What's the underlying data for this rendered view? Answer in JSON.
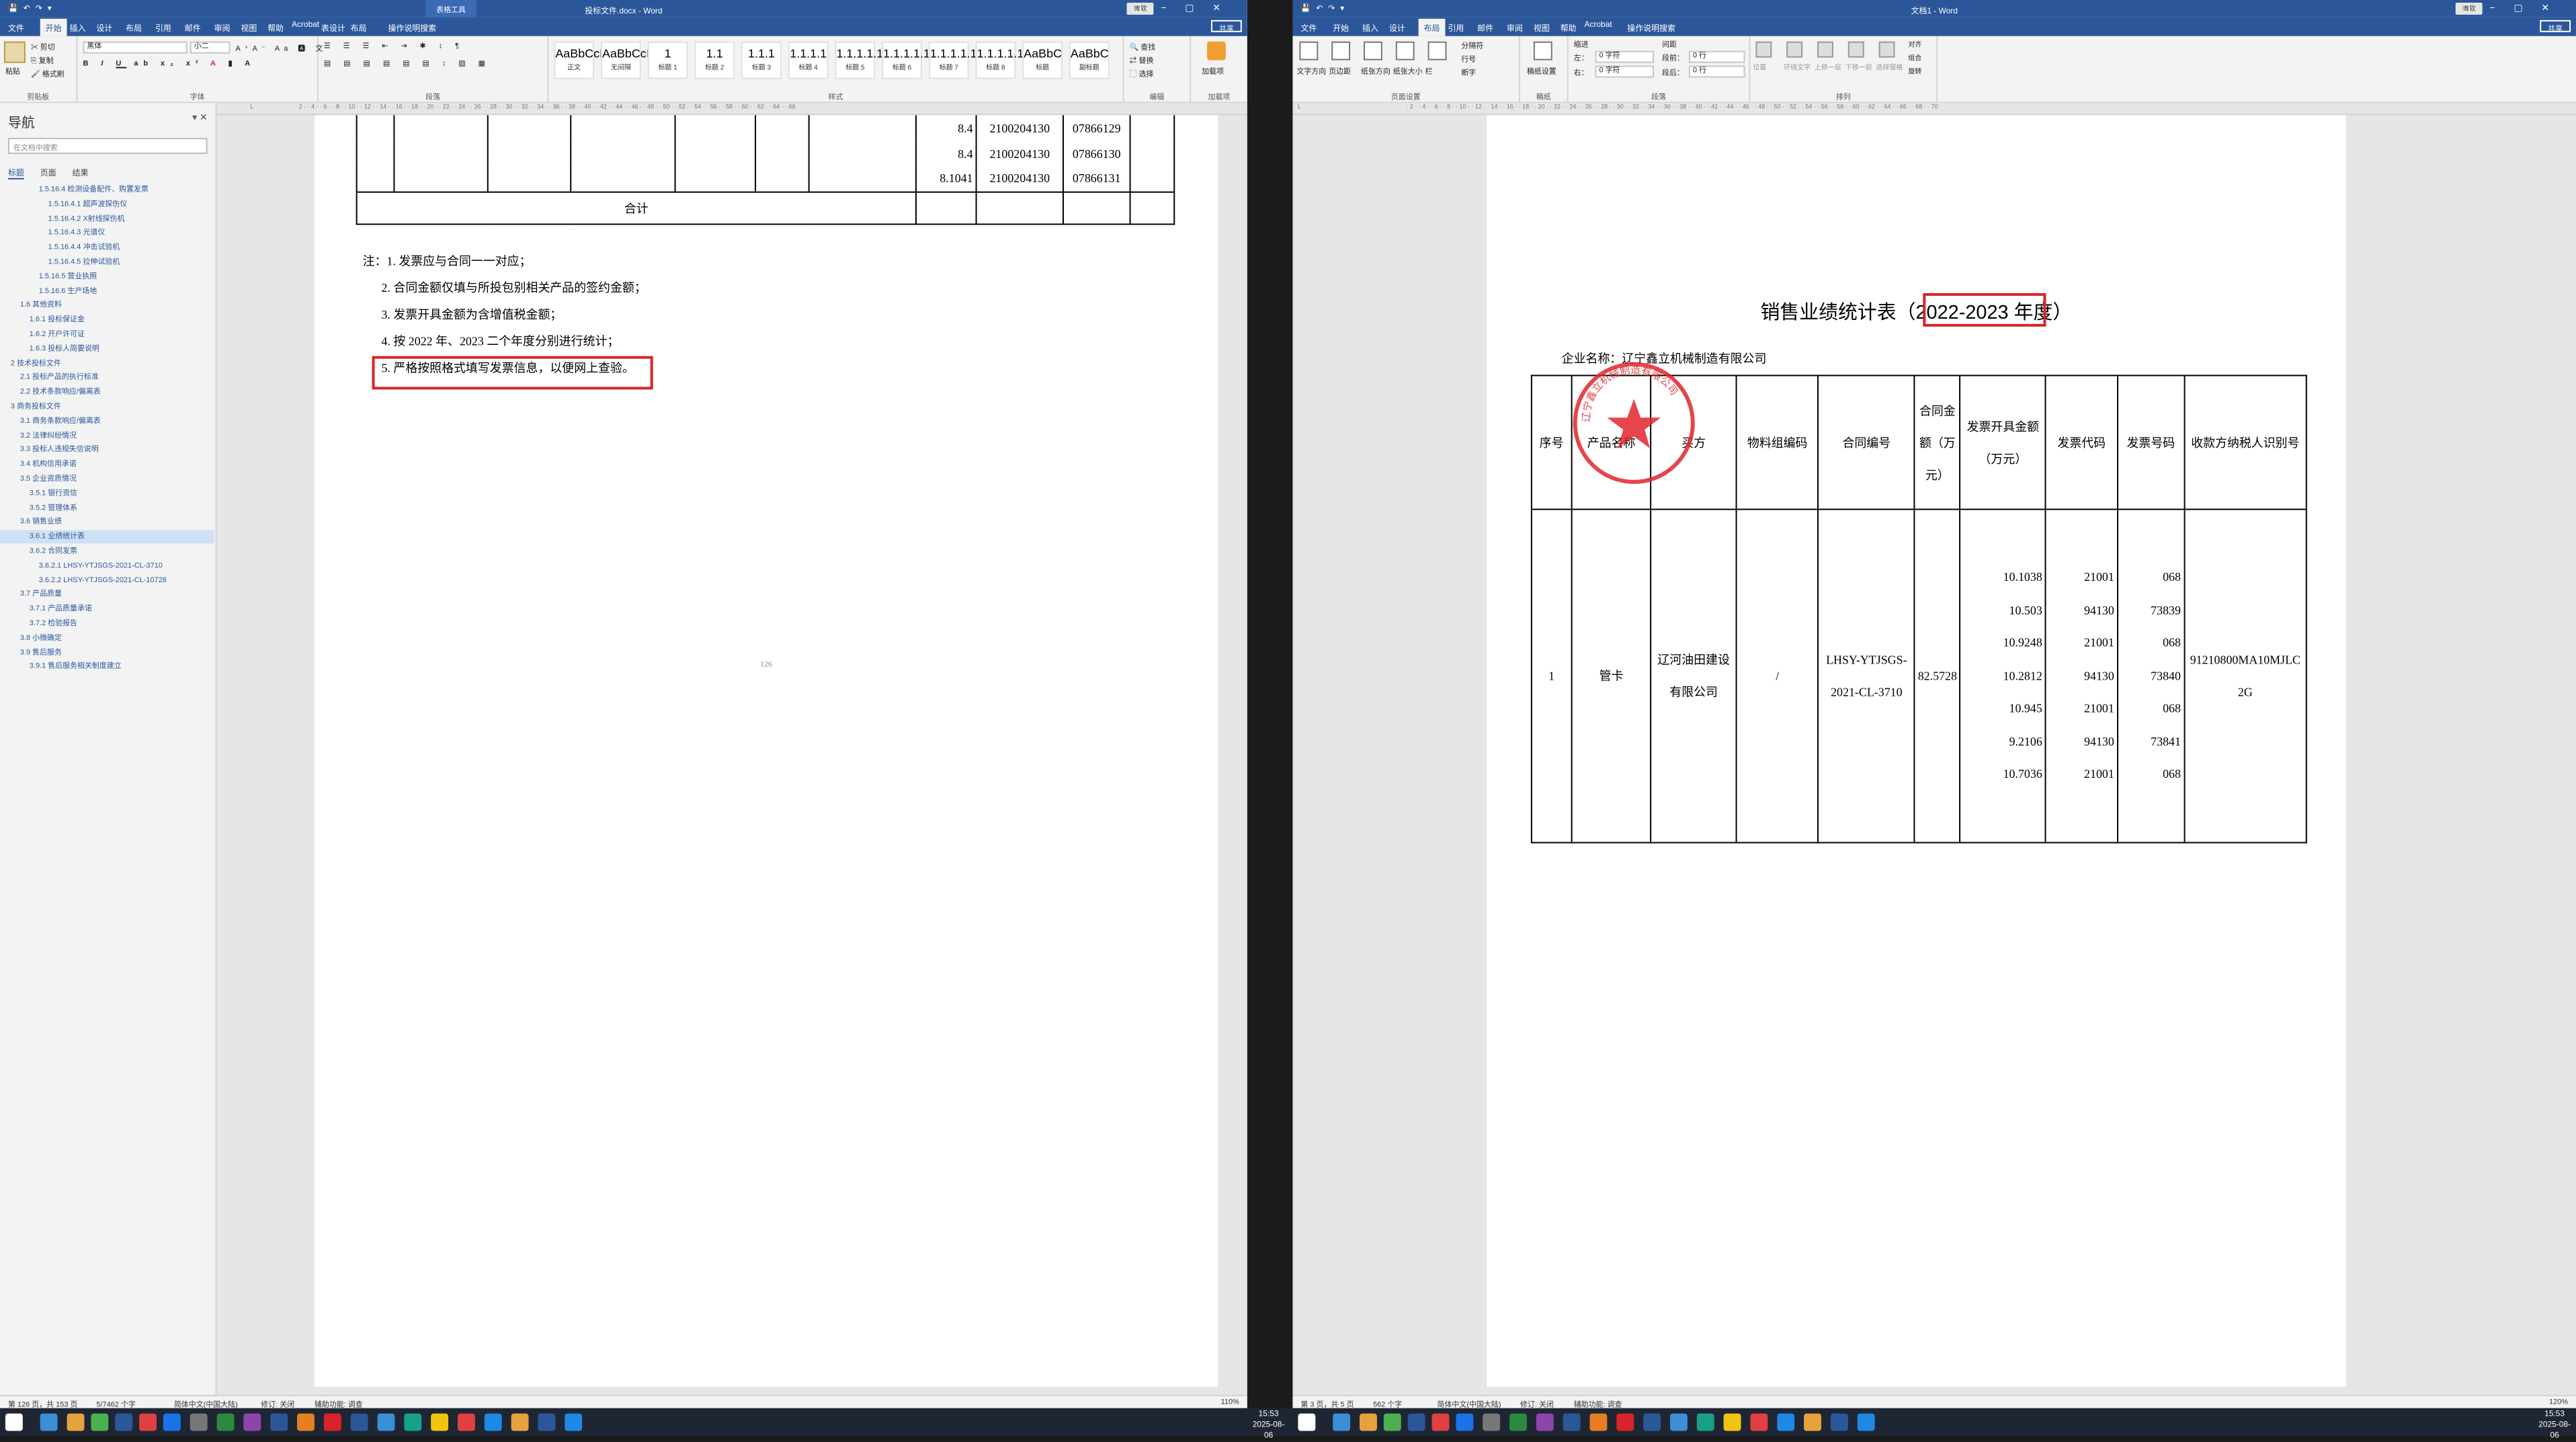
{
  "left": {
    "title": "投标文件.docx - Word",
    "context_tab": "表格工具",
    "user": "微软",
    "tabs": [
      "文件",
      "开始",
      "插入",
      "设计",
      "布局",
      "引用",
      "邮件",
      "审阅",
      "视图",
      "帮助",
      "Acrobat",
      "表设计",
      "布局"
    ],
    "tell_me": "操作说明搜索",
    "share": "共享",
    "ribbon": {
      "clipboard": {
        "paste": "粘贴",
        "cut": "剪切",
        "copy": "复制",
        "format_painter": "格式刷",
        "label": "剪贴板"
      },
      "font": {
        "name": "黑体",
        "size": "小二",
        "label": "字体"
      },
      "paragraph": {
        "label": "段落"
      },
      "styles": {
        "label": "样式",
        "items": [
          {
            "preview": "AaBbCcDd",
            "name": "正文"
          },
          {
            "preview": "AaBbCcDd",
            "name": "无间隔"
          },
          {
            "preview": "1",
            "name": "标题 1"
          },
          {
            "preview": "1.1",
            "name": "标题 2"
          },
          {
            "preview": "1.1.1",
            "name": "标题 3"
          },
          {
            "preview": "1.1.1.1",
            "name": "标题 4"
          },
          {
            "preview": "1.1.1.1.1",
            "name": "标题 5"
          },
          {
            "preview": "1.1.1.1.1",
            "name": "标题 6"
          },
          {
            "preview": "1.1.1.1.1",
            "name": "标题 7"
          },
          {
            "preview": "1.1.1.1.1",
            "name": "标题 8"
          },
          {
            "preview": "AaBbC",
            "name": "标题"
          },
          {
            "preview": "AaBbC",
            "name": "副标题"
          }
        ]
      },
      "editing": {
        "find": "查找",
        "replace": "替换",
        "select": "选择",
        "label": "编辑"
      },
      "addins": {
        "name": "加载项",
        "label": "加载项"
      }
    },
    "nav": {
      "title": "导航",
      "search_placeholder": "在文档中搜索",
      "tabs": [
        "标题",
        "页面",
        "结果"
      ],
      "items": [
        "1.5.16.4 检测设备配件、购置发票",
        "1.5.16.4.1 超声波探伤仪",
        "1.5.16.4.2 X射线探伤机",
        "1.5.16.4.3 光谱仪",
        "1.5.16.4.4 冲击试验机",
        "1.5.16.4.5 拉伸试验机",
        "1.5.16.5 营业执照",
        "1.5.16.6 生产场地",
        "1.6 其他资料",
        "1.6.1 投标保证金",
        "1.6.2 开户许可证",
        "1.6.3 投标人简要说明",
        "2 技术投标文件",
        "2.1 投标产品的执行标准",
        "2.2 技术条款响应/偏离表",
        "3 商务投标文件",
        "3.1 商务条款响应/偏离表",
        "3.2 法律纠纷情况",
        "3.3 投标人违规失信说明",
        "3.4 机构信用承诺",
        "3.5 企业资质情况",
        "3.5.1 银行资信",
        "3.5.2 管理体系",
        "3.6 销售业绩",
        "3.6.1 业绩统计表",
        "3.6.2 合同发票",
        "3.6.2.1 LHSY-YTJSGS-2021-CL-3710",
        "3.6.2.2 LHSY-YTJSGS-2021-CL-10728",
        "3.7 产品质量",
        "3.7.1 产品质量承诺",
        "3.7.2 检验报告",
        "3.8 小微确定",
        "3.9 售后服务",
        "3.9.1 售后服务相关制度建立"
      ],
      "selected": "3.6.1 业绩统计表"
    },
    "page": {
      "rows": [
        {
          "v": "8.4",
          "c": "2100204130",
          "n": "07866129"
        },
        {
          "v": "8.4",
          "c": "2100204130",
          "n": "07866130"
        },
        {
          "v": "8.1041",
          "c": "2100204130",
          "n": "07866131"
        }
      ],
      "total": "合计",
      "notes": [
        "注：1. 发票应与合同一一对应；",
        "2. 合同金额仅填与所投包别相关产品的签约金额；",
        "3. 发票开具金额为含增值税金额；",
        "4. 按 2022 年、2023 二个年度分别进行统计；",
        "5. 严格按照格式填写发票信息，以便网上查验。"
      ],
      "page_number": "126"
    },
    "status": {
      "page": "第 126 页，共 153 页",
      "words": "5/7462 个字",
      "lang": "简体中文(中国大陆)",
      "track": "修订: 关闭",
      "access": "辅助功能: 调查",
      "zoom": "110%"
    }
  },
  "right": {
    "title": "文档1 - Word",
    "user": "微软",
    "tabs": [
      "文件",
      "开始",
      "插入",
      "设计",
      "布局",
      "引用",
      "邮件",
      "审阅",
      "视图",
      "帮助",
      "Acrobat"
    ],
    "tell_me": "操作说明搜索",
    "share": "共享",
    "ribbon": {
      "page_setup": {
        "label": "页面设置",
        "items": [
          "文字方向",
          "页边距",
          "纸张方向",
          "纸张大小",
          "栏",
          "分隔符",
          "行号",
          "断字"
        ]
      },
      "draft": {
        "label": "稿纸",
        "name": "稿纸设置"
      },
      "paragraph": {
        "label": "段落",
        "indent": "缩进",
        "spacing": "间距",
        "left": "左：",
        "right": "右：",
        "before": "段前：",
        "after": "段后：",
        "left_val": "0 字符",
        "right_val": "0 字符",
        "before_val": "0 行",
        "after_val": "0 行"
      },
      "arrange": {
        "label": "排列",
        "items": [
          "位置",
          "环绕文字",
          "上移一层",
          "下移一层",
          "选择窗格",
          "对齐",
          "组合",
          "旋转"
        ]
      }
    },
    "page": {
      "title_prefix": "销售业绩统计表（",
      "title_years": "2022-2023",
      "title_suffix": "年度）",
      "company_label": "企业名称：",
      "company": "辽宁鑫立机械制造有限公司",
      "headers": [
        "序号",
        "产品名称",
        "买方",
        "物料组编码",
        "合同编号",
        "合同金额（万元）",
        "发票开具金额（万元）",
        "发票代码",
        "发票号码",
        "收款方纳税人识别号"
      ],
      "row": {
        "no": "1",
        "product": "管卡",
        "buyer": "辽河油田建设有限公司",
        "material": "/",
        "contract": "LHSY-YTJSGS-2021-CL-3710",
        "amount": "82.5728",
        "invoice_amounts": [
          "10.1038",
          "10.503",
          "10.9248",
          "10.2812",
          "10.945",
          "9.2106",
          "10.7036"
        ],
        "codes": [
          "21001",
          "94130",
          "21001",
          "94130",
          "21001",
          "94130",
          "21001"
        ],
        "numbers": [
          "068",
          "73839",
          "068",
          "73840",
          "068",
          "73841",
          "068"
        ],
        "taxid": "91210800MA10MJLC2G"
      },
      "seal": "辽宁鑫立机械制造有限公司"
    },
    "status": {
      "page": "第 3 页，共 5 页",
      "words": "562 个字",
      "lang": "简体中文(中国大陆)",
      "track": "修订: 关闭",
      "access": "辅助功能: 调查",
      "zoom": "120%"
    }
  },
  "taskbar": {
    "time": "15:53",
    "date": "2025-08-06"
  },
  "colors": {
    "word_blue": "#2b579a",
    "highlight_red": "#d8232a",
    "seal_red": "#e0242b"
  }
}
